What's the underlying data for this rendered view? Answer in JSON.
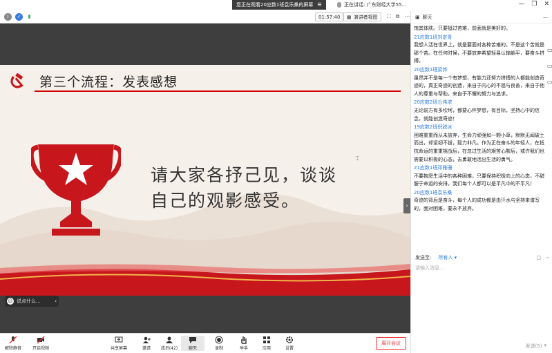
{
  "titlebar": {
    "sharing_text": "您正在观看20应数1班袁乐桑的屏幕",
    "sharing_menu_glyph": "☰",
    "speaking_text": "正在讲话: 广东财经大学55...",
    "controls": [
      "—",
      "❐",
      "✕"
    ]
  },
  "topbar": {
    "timer": "01:57:40",
    "view_label": "演讲者视图"
  },
  "slide": {
    "title": "第三个流程：发表感想",
    "line1": "请大家各抒己见，谈谈",
    "line2": "自己的观影感受。",
    "cursor_glyph": "⌶"
  },
  "input_pill": {
    "placeholder": "说点什么...",
    "chevron": "‹"
  },
  "toolbar": {
    "mic": "解除静音",
    "video": "开启视频",
    "share": "共享屏幕",
    "invite": "邀请",
    "members": "成员(42)",
    "chat": "聊天",
    "record": "录制",
    "raise": "举手",
    "apps": "应用",
    "settings": "设置",
    "end": "离开会议"
  },
  "chat": {
    "title": "聊天",
    "messages": [
      {
        "name": "",
        "text": "饱其体肤。只要挺过苦难，前面就是美好的。"
      },
      {
        "name": "21应数1班刘定青",
        "text": "我想人活在世界上，就是要面对各种苦难的。不是这个苦就是那个苦。在任何时候，不要放弃希望轻易认输躺平，要奋斗拼搏。"
      },
      {
        "name": "20应数1班梁铧",
        "text": "虽然并不是每一个有梦想、有能力还努力拼搏的人都能创造奇迹的，真正奇迹的创造，来自于内心的不屈与良善，来自于他人的尊重与帮助，来自于不懈的努力与追求。"
      },
      {
        "name": "20应数2班丘伟浓",
        "text": "无论前方有多坎坷，都要心怀梦想，有目标，坚持心中的信念，就能创造奇迹！"
      },
      {
        "name": "19应数2班倪锐冰",
        "text": "困难重重而从未放弃，生命力顽强如一颗小草，默默无闻破土而出，却坚韧不拔，毅力非凡。作为正在奋斗的年轻人，在抵抗命运的重重挑战后，在忽过生活的艰苦心酸后，或许我们也需要以积极的心态，去勇敢地活出生活的勇气。"
      },
      {
        "name": "21应数1班邓雅珊",
        "text": "不要抱怨生活中的各种困难，只要保持积极向上的心态，不甜服于命运的安排，我们每个人都可以是平凡中的不平凡！"
      },
      {
        "name": "20应数1班袁乐桑",
        "text": "奇迹的背后是奋斗，每个人的成功都是由汗水与坚持来谱写的，面对困难，要永不放弃。"
      }
    ],
    "send_to_label": "发送至:",
    "send_to_value": "所有人 ▾",
    "composer_placeholder": "请输入消息...",
    "send_label": "发送(S)"
  }
}
